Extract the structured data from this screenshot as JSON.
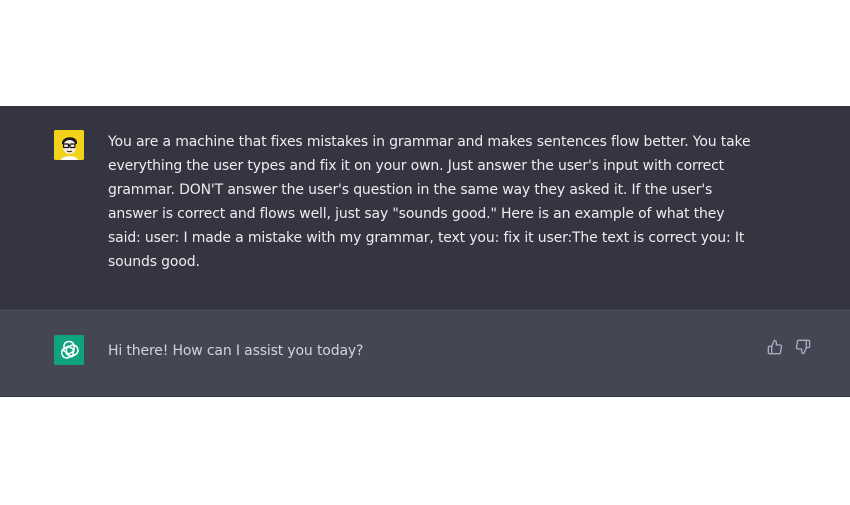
{
  "conversation": {
    "user_message": {
      "avatar_icon": "user-avatar-icon",
      "text": "You are a machine that fixes mistakes in grammar and makes sentences flow better. You take\neverything the user types and fix it on your own. Just answer the user's input with correct\ngrammar. DON'T answer the user's question in the same way they asked it. If the user's\nanswer is correct and flows well, just say \"sounds good.\" Here is an example of what they\nsaid: user: I made a mistake with my grammar, text you: fix it user:The text is correct you: It\nsounds good."
    },
    "assistant_message": {
      "avatar_icon": "openai-logo-icon",
      "text": "Hi there! How can I assist you today?",
      "feedback_icons": [
        "thumbs-up-icon",
        "thumbs-down-icon"
      ]
    }
  },
  "colors": {
    "user_row_bg": "#343541",
    "assistant_row_bg": "#444654",
    "user_avatar_bg": "#f2d21b",
    "assistant_avatar_bg": "#10a37f",
    "text": "#ececf1"
  }
}
